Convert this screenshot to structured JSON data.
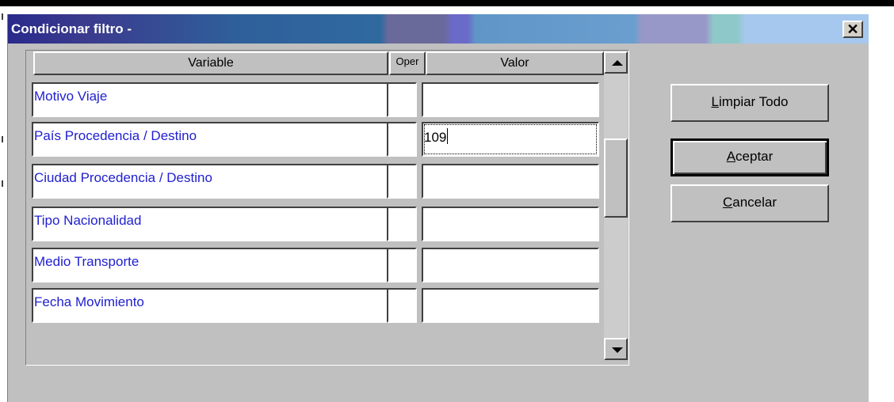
{
  "window": {
    "title": "Condicionar filtro -",
    "close_glyph": "✕"
  },
  "grid": {
    "headers": {
      "variable": "Variable",
      "oper": "Oper",
      "valor": "Valor"
    },
    "rows": [
      {
        "variable": "Motivo Viaje",
        "oper": "",
        "valor": ""
      },
      {
        "variable": "País Procedencia / Destino",
        "oper": "",
        "valor": "109"
      },
      {
        "variable": "Ciudad Procedencia / Destino",
        "oper": "",
        "valor": ""
      },
      {
        "variable": "Tipo Nacionalidad",
        "oper": "",
        "valor": ""
      },
      {
        "variable": "Medio Transporte",
        "oper": "",
        "valor": ""
      },
      {
        "variable": "Fecha Movimiento",
        "oper": "",
        "valor": ""
      }
    ]
  },
  "buttons": {
    "limpiar": {
      "mnemonic": "L",
      "rest": "impiar Todo"
    },
    "aceptar": {
      "mnemonic": "A",
      "rest": "ceptar"
    },
    "cancelar": {
      "mnemonic": "C",
      "rest": "ancelar"
    }
  },
  "colors": {
    "variable_text": "#2020d0",
    "face": "#c0c0c0"
  },
  "icons": {
    "close": "close-icon",
    "up": "arrow-up-icon",
    "down": "arrow-down-icon"
  }
}
